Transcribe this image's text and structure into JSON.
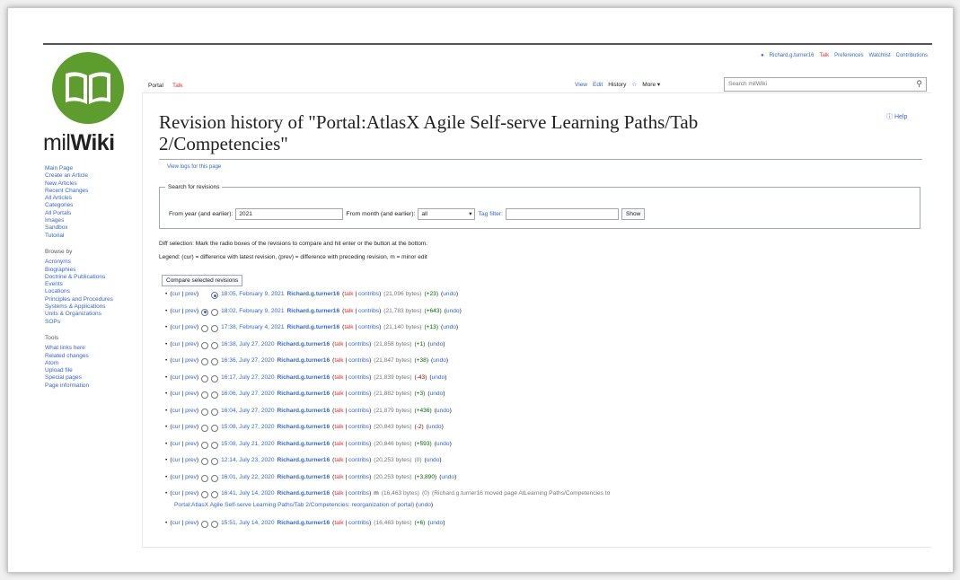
{
  "site": {
    "wordmark_light": "mil",
    "wordmark_bold": "Wiki"
  },
  "personal": {
    "user": "Richard.g.turner16",
    "talk": "Talk",
    "preferences": "Preferences",
    "watchlist": "Watchlist",
    "contributions": "Contributions"
  },
  "tabs": {
    "portal": "Portal",
    "talk": "Talk",
    "view": "View",
    "edit": "Edit",
    "history": "History",
    "more": "More"
  },
  "search": {
    "placeholder": "Search milWiki"
  },
  "page": {
    "title_line1": "Revision history of \"Portal:AtlasX Agile Self-serve Learning Paths/Tab",
    "title_line2": "2/Competencies\"",
    "help": "Help",
    "view_logs": "View logs for this page"
  },
  "search_revisions": {
    "legend": "Search for revisions",
    "from_year_label": "From year (and earlier):",
    "from_year_value": "2021",
    "from_month_label": "From month (and earlier):",
    "from_month_value": "all",
    "tag_filter_label": "Tag filter:",
    "tag_filter_value": "",
    "show_button": "Show"
  },
  "diff_selection": "Diff selection: Mark the radio boxes of the revisions to compare and hit enter or the button at the bottom.",
  "legend_line": "Legend: (cur) = difference with latest revision, (prev) = difference with preceding revision, m = minor edit",
  "compare_button": "Compare selected revisions",
  "sidebar": {
    "nav": [
      "Main Page",
      "Create an Article",
      "New Articles",
      "Recent Changes",
      "All Articles",
      "Categories",
      "All Portals",
      "Images",
      "Sandbox",
      "Tutorial"
    ],
    "browse_title": "Browse by",
    "browse": [
      "Acronyms",
      "Biographies",
      "Doctrine & Publications",
      "Events",
      "Locations",
      "Principles and Procedures",
      "Systems & Applications",
      "Units & Organizations",
      "SOPs"
    ],
    "tools_title": "Tools",
    "tools": [
      "What links here",
      "Related changes",
      "Atom",
      "Upload file",
      "Special pages",
      "Page information"
    ]
  },
  "revisions": [
    {
      "time": "18:05, February 9, 2021",
      "user": "Richard.g.turner16",
      "size": "(21,096 bytes)",
      "delta": "(+23)",
      "delta_color": "#006400",
      "minor": "",
      "summary": "",
      "summary2": "",
      "radio_left": "hidden",
      "radio_right": "on"
    },
    {
      "time": "18:02, February 9, 2021",
      "user": "Richard.g.turner16",
      "size": "(21,783 bytes)",
      "delta": "(+643)",
      "delta_color": "#006400",
      "minor": "",
      "summary": "",
      "summary2": "",
      "radio_left": "on",
      "radio_right": "off"
    },
    {
      "time": "17:38, February 4, 2021",
      "user": "Richard.g.turner16",
      "size": "(21,140 bytes)",
      "delta": "(+13)",
      "delta_color": "#006400",
      "minor": "",
      "summary": "",
      "summary2": "",
      "radio_left": "off",
      "radio_right": "off"
    },
    {
      "time": "16:38, July 27, 2020",
      "user": "Richard.g.turner16",
      "size": "(21,858 bytes)",
      "delta": "(+1)",
      "delta_color": "#006400",
      "minor": "",
      "summary": "",
      "summary2": "",
      "radio_left": "off",
      "radio_right": "off"
    },
    {
      "time": "16:36, July 27, 2020",
      "user": "Richard.g.turner16",
      "size": "(21,847 bytes)",
      "delta": "(+38)",
      "delta_color": "#006400",
      "minor": "",
      "summary": "",
      "summary2": "",
      "radio_left": "off",
      "radio_right": "off"
    },
    {
      "time": "16:17, July 27, 2020",
      "user": "Richard.g.turner16",
      "size": "(21,839 bytes)",
      "delta": "(-43)",
      "delta_color": "#8b0000",
      "minor": "",
      "summary": "",
      "summary2": "",
      "radio_left": "off",
      "radio_right": "off"
    },
    {
      "time": "16:06, July 27, 2020",
      "user": "Richard.g.turner16",
      "size": "(21,882 bytes)",
      "delta": "(+3)",
      "delta_color": "#006400",
      "minor": "",
      "summary": "",
      "summary2": "",
      "radio_left": "off",
      "radio_right": "off"
    },
    {
      "time": "16:04, July 27, 2020",
      "user": "Richard.g.turner16",
      "size": "(21,879 bytes)",
      "delta": "(+436)",
      "delta_color": "#006400",
      "minor": "",
      "summary": "",
      "summary2": "",
      "radio_left": "off",
      "radio_right": "off"
    },
    {
      "time": "15:08, July 27, 2020",
      "user": "Richard.g.turner16",
      "size": "(20,843 bytes)",
      "delta": "(-2)",
      "delta_color": "#8b0000",
      "minor": "",
      "summary": "",
      "summary2": "",
      "radio_left": "off",
      "radio_right": "off"
    },
    {
      "time": "15:08, July 21, 2020",
      "user": "Richard.g.turner16",
      "size": "(20,846 bytes)",
      "delta": "(+593)",
      "delta_color": "#006400",
      "minor": "",
      "summary": "",
      "summary2": "",
      "radio_left": "off",
      "radio_right": "off"
    },
    {
      "time": "12:14, July 23, 2020",
      "user": "Richard.g.turner16",
      "size": "(20,253 bytes)",
      "delta": "(0)",
      "delta_color": "#72777d",
      "minor": "",
      "summary": "",
      "summary2": "",
      "radio_left": "off",
      "radio_right": "off"
    },
    {
      "time": "16:01, July 22, 2020",
      "user": "Richard.g.turner16",
      "size": "(20,253 bytes)",
      "delta": "(+3,890)",
      "delta_color": "#006400",
      "minor": "",
      "summary": "",
      "summary2": "",
      "radio_left": "off",
      "radio_right": "off"
    },
    {
      "time": "16:41, July 14, 2020",
      "user": "Richard.g.turner16",
      "size": "(16,463 bytes)",
      "delta": "(0)",
      "delta_color": "#72777d",
      "minor": "m",
      "summary": "(Richard.g.turner16 moved page AtLearning Paths/Competencies to",
      "summary2": "Portal:AtlasX Agile Self-serve Learning Paths/Tab 2/Competencies: reorganization of portal)",
      "radio_left": "off",
      "radio_right": "off"
    },
    {
      "time": "15:51, July 14, 2020",
      "user": "Richard.g.turner16",
      "size": "(16,463 bytes)",
      "delta": "(+6)",
      "delta_color": "#006400",
      "minor": "",
      "summary": "",
      "summary2": "",
      "radio_left": "off",
      "radio_right": "off"
    }
  ],
  "labels": {
    "cur": "cur",
    "prev": "prev",
    "talk": "talk",
    "contribs": "contribs",
    "undo": "undo"
  }
}
